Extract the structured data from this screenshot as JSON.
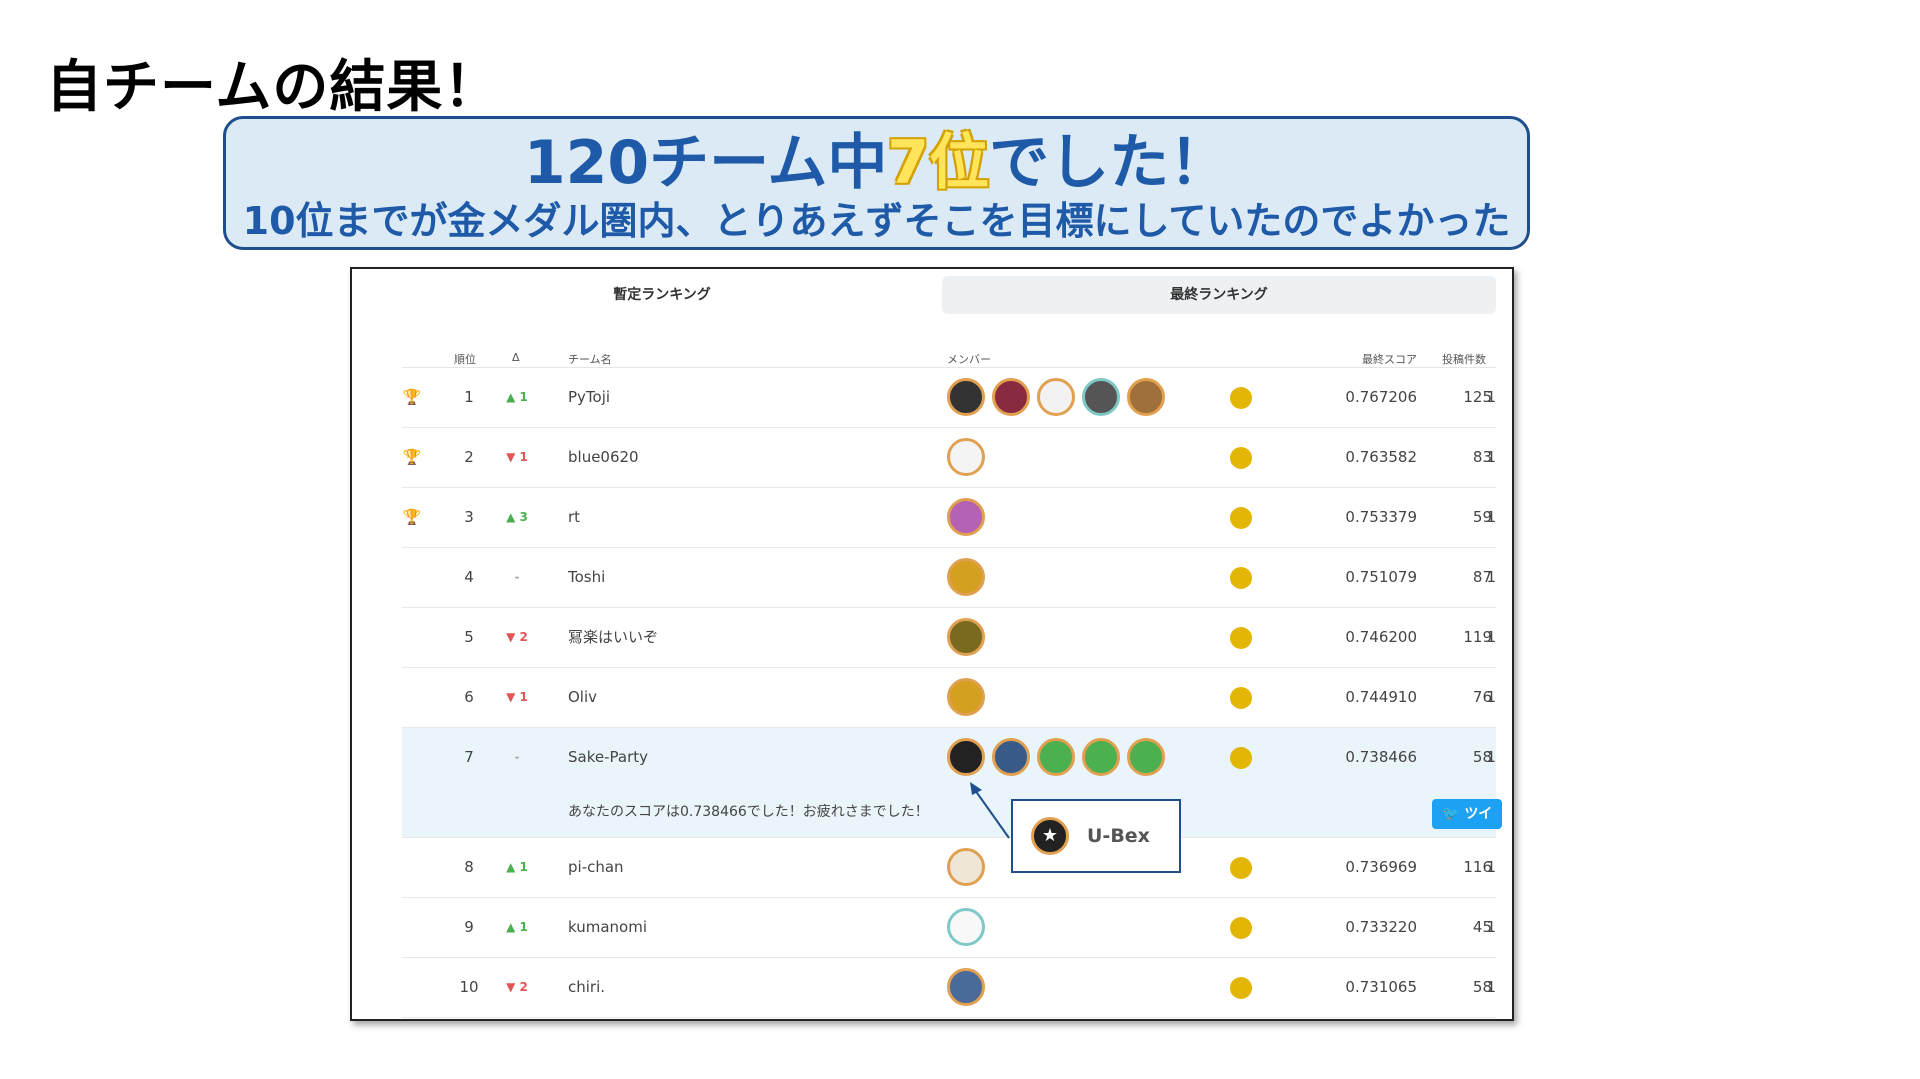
{
  "slide": {
    "title": "自チームの結果！",
    "banner_main_prefix": "120チーム中",
    "banner_main_highlight": "7位",
    "banner_main_suffix": "でした！",
    "banner_sub": "10位までが金メダル圏内、とりあえずそこを目標にしていたのでよかった"
  },
  "tabs": {
    "provisional": "暫定ランキング",
    "final": "最終ランキング"
  },
  "table": {
    "headers": {
      "rank": "順位",
      "delta": "Δ",
      "team": "チーム名",
      "members": "メンバー",
      "score": "最終スコア",
      "entries": "投稿件数"
    },
    "rows": [
      {
        "trophy": "🏆",
        "rank": "1",
        "delta": "▲ 1",
        "dir": "up",
        "team": "PyToji",
        "score": "0.767206",
        "entries": "125",
        "extra": "1"
      },
      {
        "trophy": "🏆",
        "rank": "2",
        "delta": "▼ 1",
        "dir": "down",
        "team": "blue0620",
        "score": "0.763582",
        "entries": "83",
        "extra": "1"
      },
      {
        "trophy": "🏆",
        "rank": "3",
        "delta": "▲ 3",
        "dir": "up",
        "team": "rt",
        "score": "0.753379",
        "entries": "59",
        "extra": "1"
      },
      {
        "trophy": "",
        "rank": "4",
        "delta": "-",
        "dir": "same",
        "team": "Toshi",
        "score": "0.751079",
        "entries": "87",
        "extra": "1"
      },
      {
        "trophy": "",
        "rank": "5",
        "delta": "▼ 2",
        "dir": "down",
        "team": "冩楽はいいぞ",
        "score": "0.746200",
        "entries": "119",
        "extra": "1"
      },
      {
        "trophy": "",
        "rank": "6",
        "delta": "▼ 1",
        "dir": "down",
        "team": "Oliv",
        "score": "0.744910",
        "entries": "76",
        "extra": "1"
      },
      {
        "trophy": "",
        "rank": "7",
        "delta": "-",
        "dir": "same",
        "team": "Sake-Party",
        "score": "0.738466",
        "entries": "58",
        "extra": "1"
      },
      {
        "trophy": "",
        "rank": "8",
        "delta": "▲ 1",
        "dir": "up",
        "team": "pi-chan",
        "score": "0.736969",
        "entries": "116",
        "extra": "1"
      },
      {
        "trophy": "",
        "rank": "9",
        "delta": "▲ 1",
        "dir": "up",
        "team": "kumanomi",
        "score": "0.733220",
        "entries": "45",
        "extra": "1"
      },
      {
        "trophy": "",
        "rank": "10",
        "delta": "▼ 2",
        "dir": "down",
        "team": "chiri.",
        "score": "0.731065",
        "entries": "58",
        "extra": "1"
      }
    ],
    "message": "あなたのスコアは0.738466でした！お疲れさまでした！",
    "tweet_label": "ツイ"
  },
  "callout": {
    "name": "U-Bex"
  },
  "colors": {
    "banner_text": "#1e5aa8",
    "highlight": "#ffe45c",
    "medal_gold": "#e3b505",
    "up": "#4caf50",
    "down": "#e05555"
  }
}
